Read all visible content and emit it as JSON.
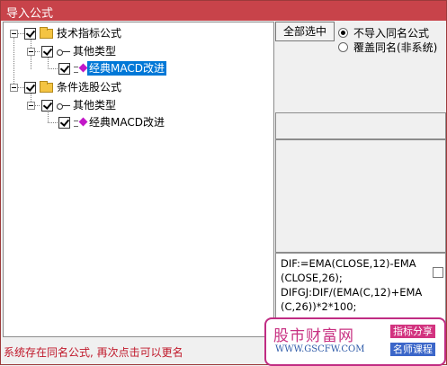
{
  "window": {
    "title": "导入公式"
  },
  "tree": {
    "nodes": [
      {
        "label": "技术指标公式"
      },
      {
        "label": "其他类型"
      },
      {
        "label": "经典MACD改进"
      },
      {
        "label": "条件选股公式"
      },
      {
        "label": "其他类型"
      },
      {
        "label": "经典MACD改进"
      }
    ]
  },
  "options": {
    "select_all_label": "全部选中",
    "radio_no_import_label": "不导入同名公式",
    "radio_overwrite_label": "覆盖同名(非系统)"
  },
  "code_preview": {
    "text": "DIF:=EMA(CLOSE,12)-EMA(CLOSE,26);\nDIFGJ:DIF/(EMA(C,12)+EMA(C,26))*2*100;"
  },
  "status": {
    "message": "系统存在同名公式, 再次点击可以更名"
  },
  "watermark": {
    "title": "股市财富网",
    "url": "WWW.GSCFW.COM",
    "tag1": "指标分享",
    "tag2": "名师课程"
  },
  "colors": {
    "titlebar": "#c8434a",
    "selection": "#0078d7",
    "status_text": "#c0182a",
    "watermark_border": "#c02c83"
  }
}
